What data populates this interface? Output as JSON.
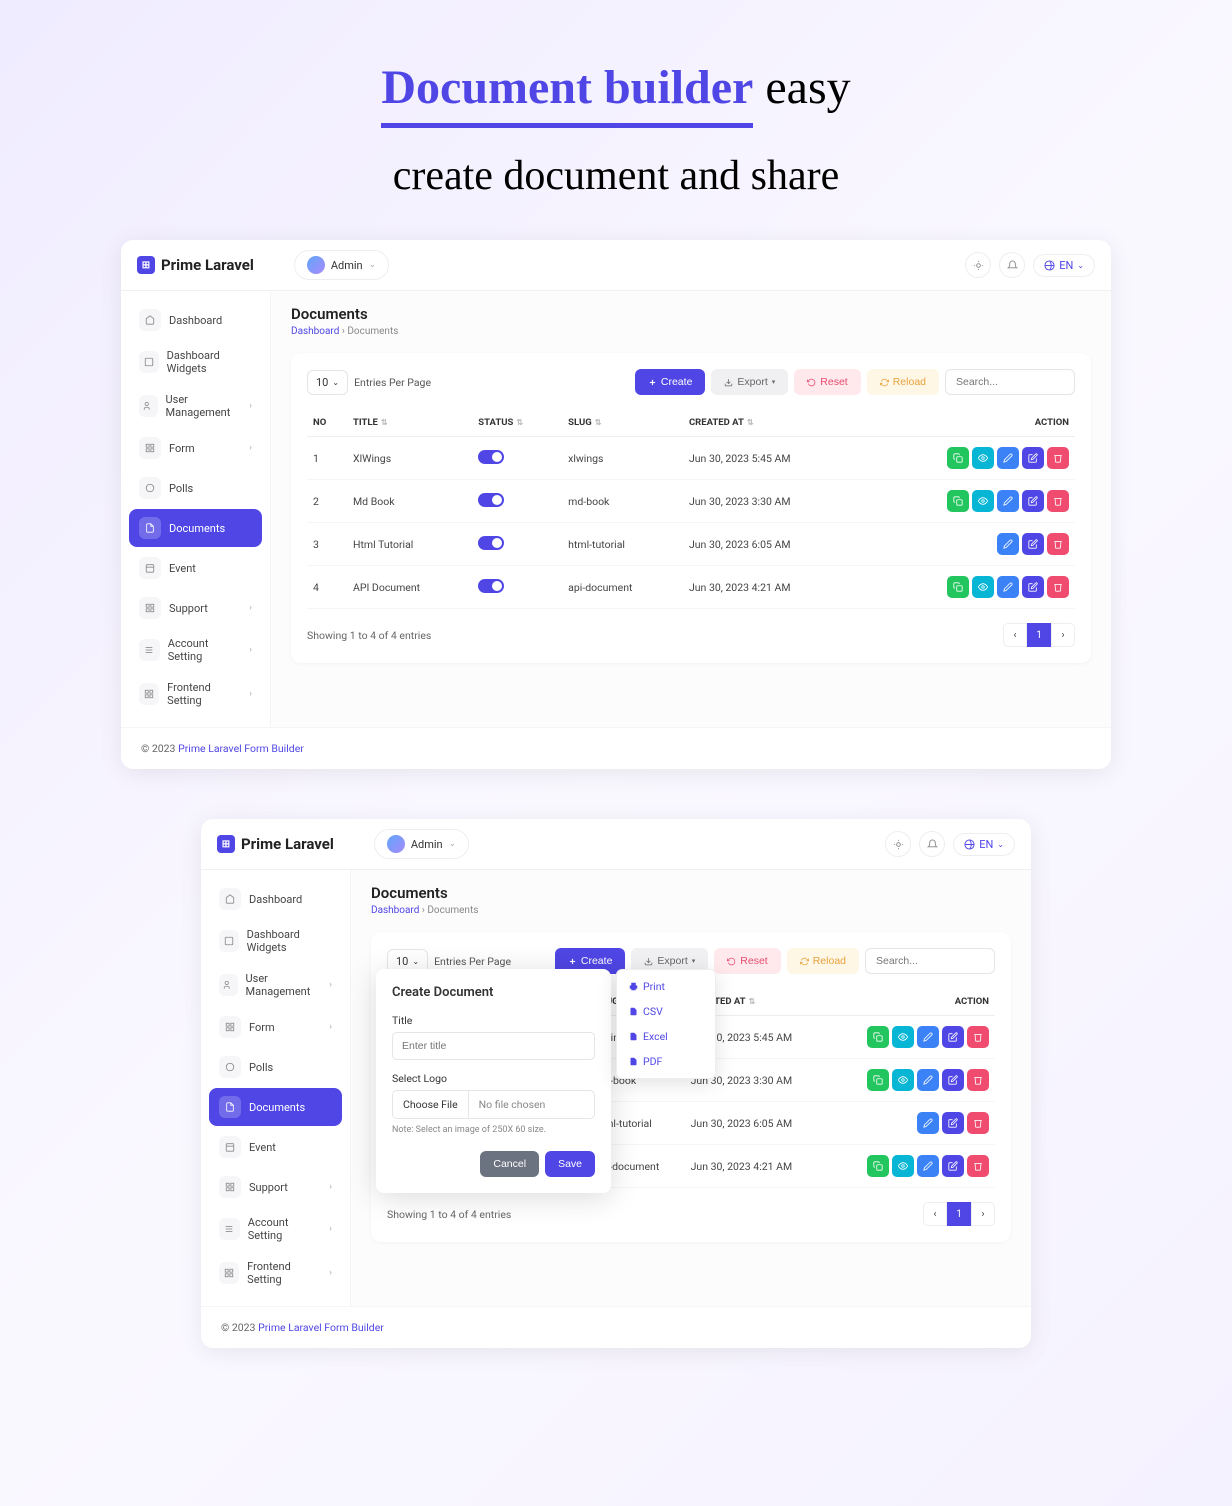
{
  "hero": {
    "strong": "Document builder",
    "rest": "easy",
    "sub": "create document and share"
  },
  "brand": "Prime Laravel",
  "user": {
    "name": "Admin"
  },
  "lang": "EN",
  "nav": [
    {
      "label": "Dashboard",
      "icon": "home"
    },
    {
      "label": "Dashboard Widgets",
      "icon": "square"
    },
    {
      "label": "User Management",
      "icon": "users",
      "chev": true
    },
    {
      "label": "Form",
      "icon": "grid",
      "chev": true
    },
    {
      "label": "Polls",
      "icon": "circle"
    },
    {
      "label": "Documents",
      "icon": "file",
      "active": true
    },
    {
      "label": "Event",
      "icon": "calendar"
    },
    {
      "label": "Support",
      "icon": "grid",
      "chev": true
    },
    {
      "label": "Account Setting",
      "icon": "sliders",
      "chev": true
    },
    {
      "label": "Frontend Setting",
      "icon": "grid",
      "chev": true
    }
  ],
  "page": {
    "title": "Documents",
    "breadcrumb_root": "Dashboard",
    "breadcrumb_current": "Documents"
  },
  "toolbar": {
    "page_size": "10",
    "entries_label": "Entries Per Page",
    "create": "Create",
    "export": "Export",
    "reset": "Reset",
    "reload": "Reload",
    "search_placeholder": "Search..."
  },
  "columns": {
    "no": "NO",
    "title": "TITLE",
    "status": "STATUS",
    "slug": "SLUG",
    "created": "CREATED AT",
    "action": "ACTION"
  },
  "rows": [
    {
      "no": "1",
      "title": "XlWings",
      "slug": "xlwings",
      "created": "Jun 30, 2023 5:45 AM",
      "variant": "full"
    },
    {
      "no": "2",
      "title": "Md Book",
      "slug": "md-book",
      "created": "Jun 30, 2023 3:30 AM",
      "variant": "full"
    },
    {
      "no": "3",
      "title": "Html Tutorial",
      "slug": "html-tutorial",
      "created": "Jun 30, 2023 6:05 AM",
      "variant": "short"
    },
    {
      "no": "4",
      "title": "API Document",
      "slug": "api-document",
      "created": "Jun 30, 2023 4:21 AM",
      "variant": "full"
    }
  ],
  "table_info": "Showing 1 to 4 of 4 entries",
  "page_current": "1",
  "footer": {
    "prefix": "© 2023 ",
    "link": "Prime Laravel Form Builder"
  },
  "modal": {
    "title": "Create Document",
    "title_label": "Title",
    "title_placeholder": "Enter title",
    "logo_label": "Select Logo",
    "choose_file": "Choose File",
    "no_file": "No file chosen",
    "note": "Note: Select an image of 250X 60 size.",
    "cancel": "Cancel",
    "save": "Save"
  },
  "export_menu": {
    "print": "Print",
    "csv": "CSV",
    "excel": "Excel",
    "pdf": "PDF"
  }
}
